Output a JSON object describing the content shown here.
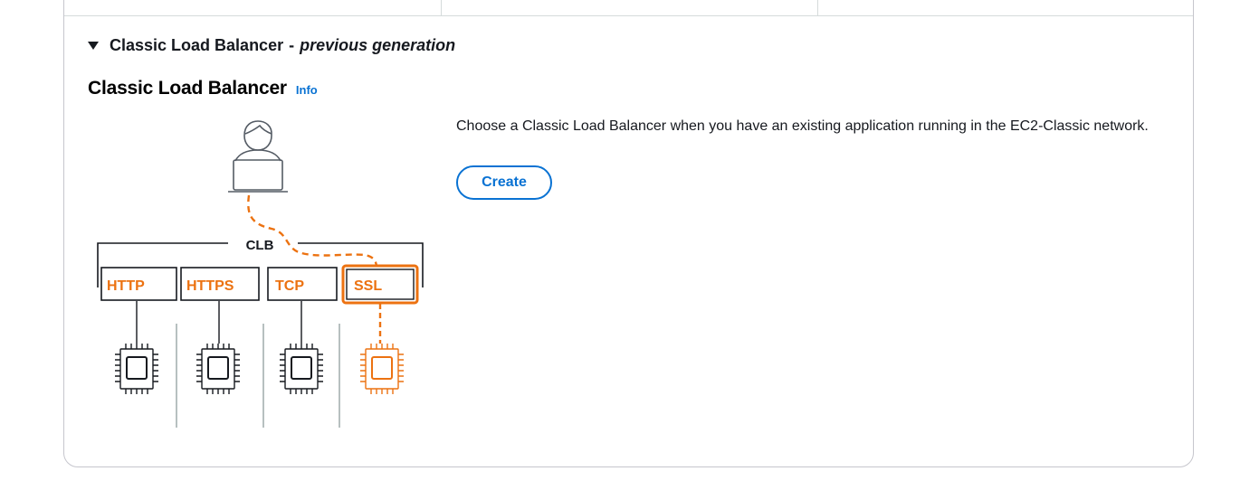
{
  "section": {
    "expander_label": "Classic Load Balancer",
    "expander_dash": "-",
    "expander_subtitle": "previous generation"
  },
  "classic": {
    "title": "Classic Load Balancer",
    "info_link": "Info",
    "description": "Choose a Classic Load Balancer when you have an existing application running in the EC2-Classic network.",
    "create_button": "Create"
  },
  "diagram": {
    "clb_label": "CLB",
    "listeners": [
      "HTTP",
      "HTTPS",
      "TCP",
      "SSL"
    ],
    "highlighted_listener": "SSL",
    "icons": [
      "user-laptop-icon",
      "chip-icon"
    ]
  },
  "colors": {
    "accent_orange": "#ec7211",
    "link_blue": "#0972d3",
    "text": "#16191f",
    "border": "#c6c6cd"
  }
}
